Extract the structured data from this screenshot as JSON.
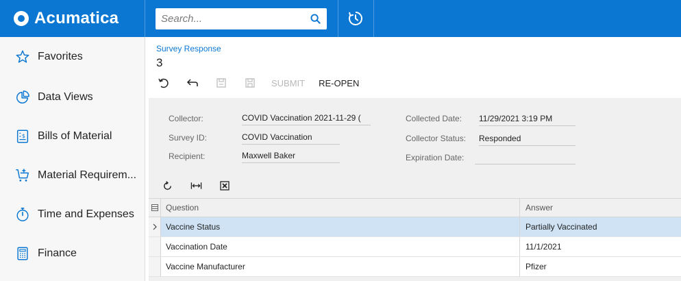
{
  "app": {
    "brand": "Acumatica",
    "brand_color": "#0b77d2"
  },
  "search": {
    "placeholder": "Search..."
  },
  "sidebar": {
    "items": [
      {
        "label": "Favorites",
        "icon": "star-icon"
      },
      {
        "label": "Data Views",
        "icon": "pie-chart-icon"
      },
      {
        "label": "Bills of Material",
        "icon": "bill-icon"
      },
      {
        "label": "Material Requirem...",
        "icon": "cart-plus-icon"
      },
      {
        "label": "Time and Expenses",
        "icon": "stopwatch-icon"
      },
      {
        "label": "Finance",
        "icon": "calculator-icon"
      }
    ]
  },
  "page": {
    "breadcrumb": "Survey Response",
    "title": "3"
  },
  "toolbar": {
    "submit_label": "SUBMIT",
    "reopen_label": "RE-OPEN"
  },
  "form": {
    "collector": {
      "label": "Collector:",
      "value": "COVID Vaccination 2021-11-29 ("
    },
    "survey_id": {
      "label": "Survey ID:",
      "value": "COVID Vaccination"
    },
    "recipient": {
      "label": "Recipient:",
      "value": "Maxwell Baker"
    },
    "collected_date": {
      "label": "Collected Date:",
      "value": "11/29/2021 3:19 PM"
    },
    "collector_status": {
      "label": "Collector Status:",
      "value": "Responded"
    },
    "expiration_date": {
      "label": "Expiration Date:",
      "value": ""
    }
  },
  "grid": {
    "columns": {
      "question": "Question",
      "answer": "Answer"
    },
    "rows": [
      {
        "question": "Vaccine Status",
        "answer": "Partially Vaccinated",
        "selected": true
      },
      {
        "question": "Vaccination Date",
        "answer": "11/1/2021",
        "selected": false
      },
      {
        "question": "Vaccine Manufacturer",
        "answer": "Pfizer",
        "selected": false
      }
    ]
  }
}
